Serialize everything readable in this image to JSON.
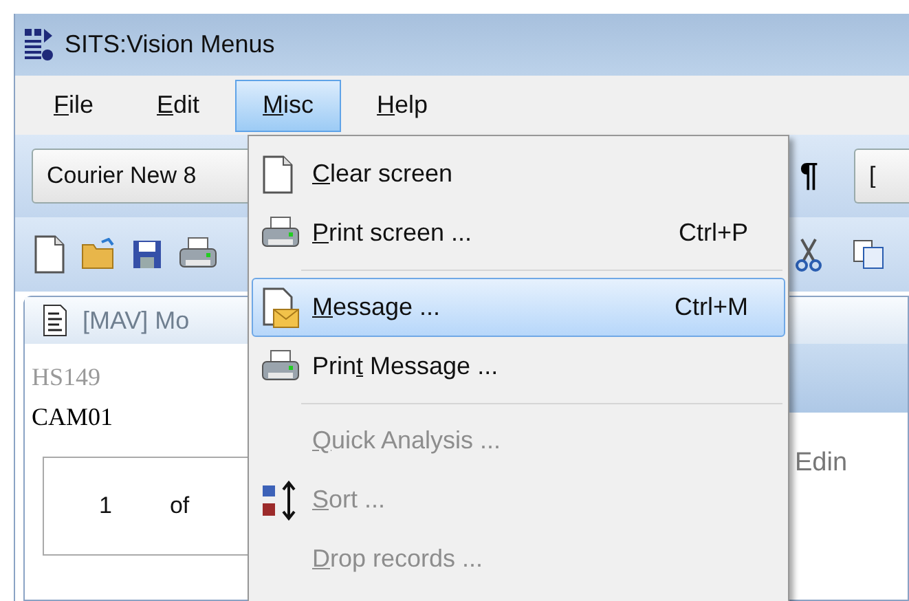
{
  "window": {
    "title": "SITS:Vision Menus"
  },
  "menu_bar": [
    {
      "access_key": "F",
      "text_after": "ile",
      "selected": false
    },
    {
      "access_key": "E",
      "text_after": "dit",
      "selected": false
    },
    {
      "access_key": "M",
      "text_after": "isc",
      "selected": true
    },
    {
      "access_key": "H",
      "text_after": "elp",
      "selected": false
    }
  ],
  "format_toolbar": {
    "font_combo": "Courier New 8",
    "paragraph_mark": "¶",
    "style_combo": "["
  },
  "child_window": {
    "title": "[MAV] Mo",
    "fields": [
      "HS149",
      "CAM01"
    ],
    "side_text": "Edin",
    "grid_header": [
      "1",
      "of"
    ]
  },
  "misc_menu": [
    {
      "kind": "item",
      "access_key": "C",
      "text_after": "lear screen",
      "disabled": false,
      "selected": false
    },
    {
      "kind": "item",
      "access_key": "P",
      "text_after": "rint screen ...",
      "shortcut": "Ctrl+P",
      "disabled": false,
      "selected": false
    },
    {
      "kind": "separator"
    },
    {
      "kind": "item",
      "access_key": "M",
      "text_after": "essage ...",
      "shortcut": "Ctrl+M",
      "disabled": false,
      "selected": true
    },
    {
      "kind": "item",
      "text_before": "Prin",
      "access_key": "t",
      "text_after": " Message ...",
      "disabled": false,
      "selected": false
    },
    {
      "kind": "separator"
    },
    {
      "kind": "item",
      "access_key": "Q",
      "text_after": "uick Analysis ...",
      "disabled": true,
      "selected": false
    },
    {
      "kind": "item",
      "access_key": "S",
      "text_after": "ort ...",
      "disabled": true,
      "selected": false
    },
    {
      "kind": "item",
      "access_key": "D",
      "text_after": "rop records ...",
      "disabled": true,
      "selected": false
    }
  ]
}
